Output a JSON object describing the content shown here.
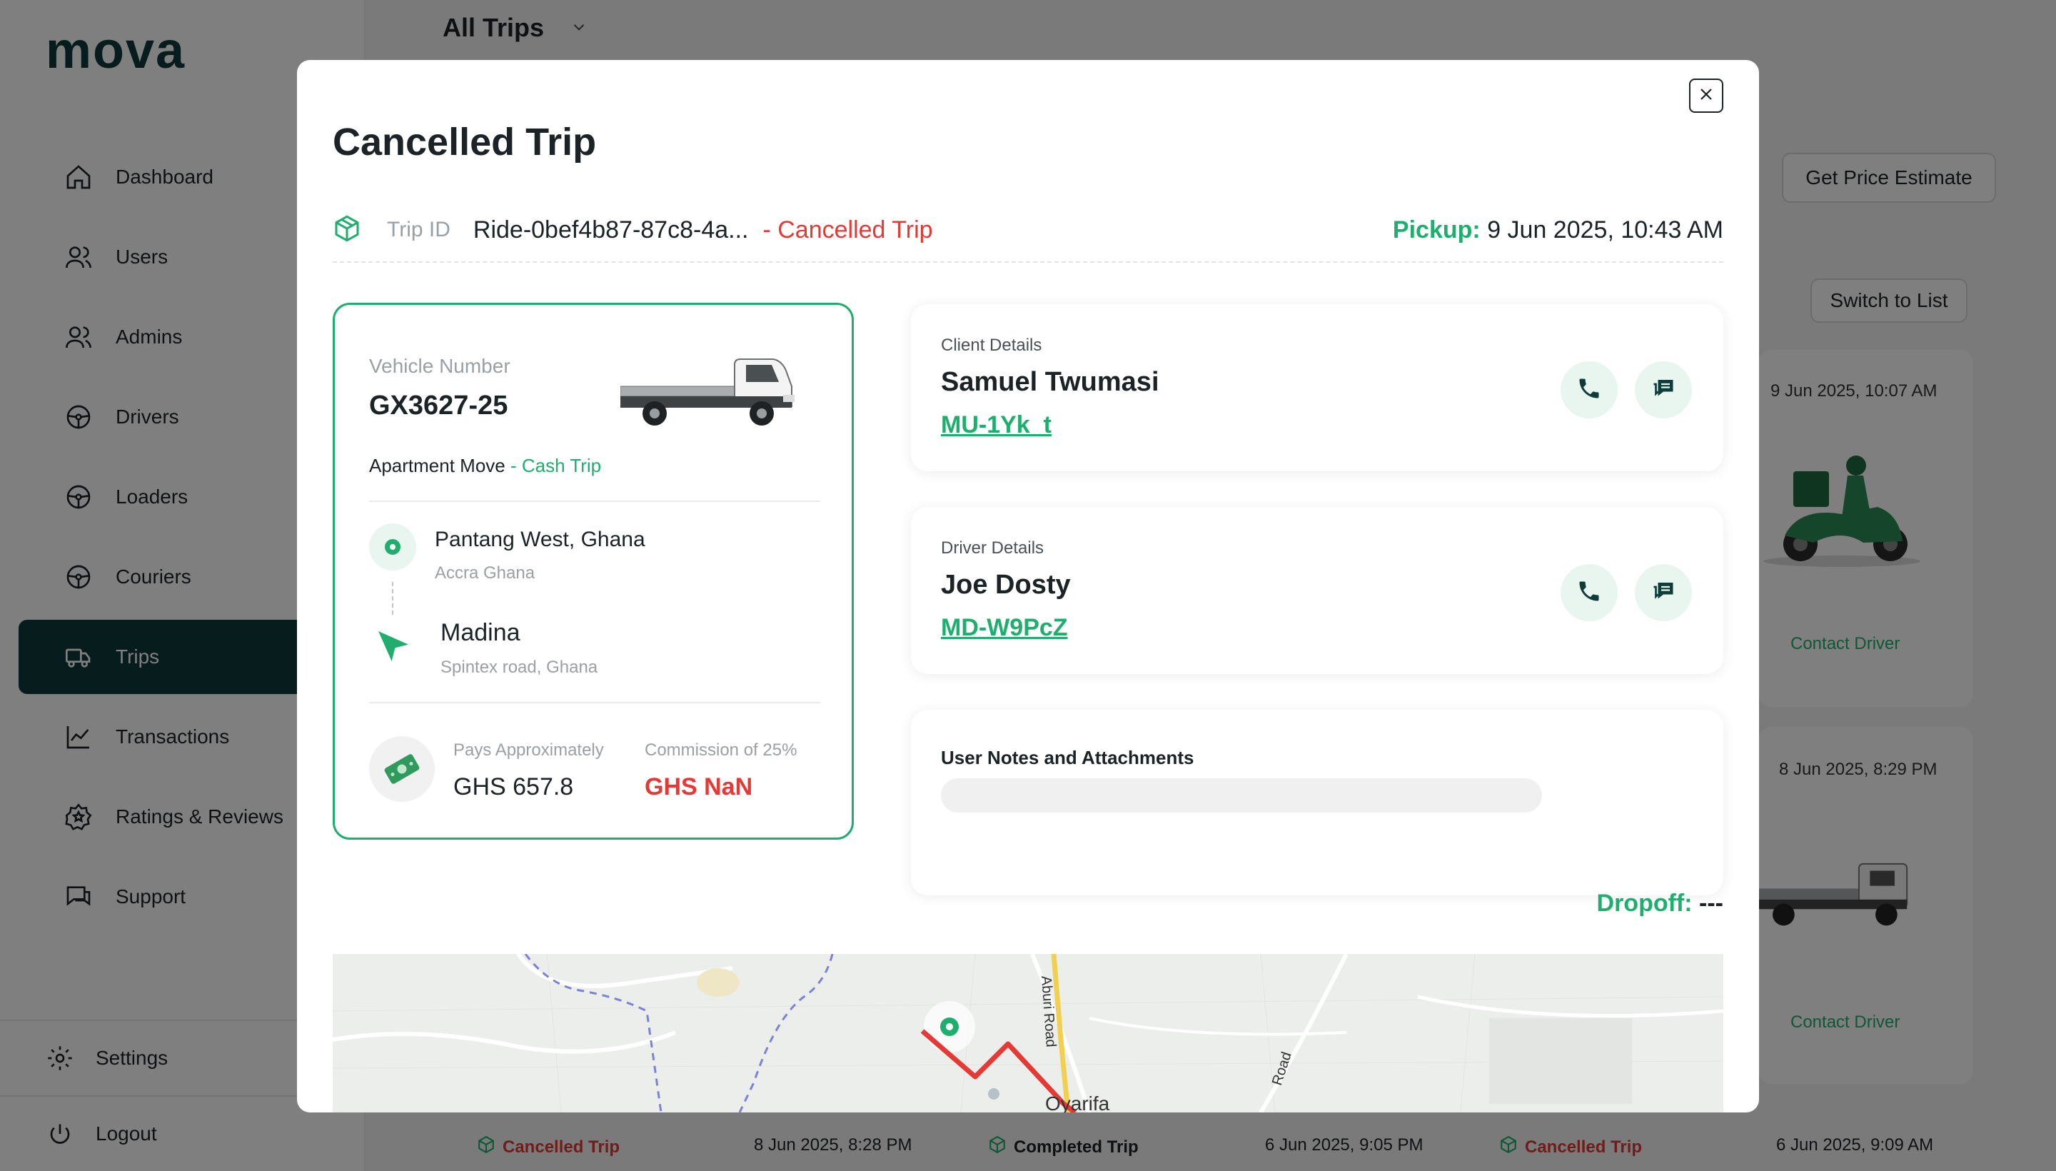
{
  "app": {
    "logo": "mova",
    "nav": [
      {
        "label": "Dashboard",
        "icon": "home-icon"
      },
      {
        "label": "Users",
        "icon": "users-icon"
      },
      {
        "label": "Admins",
        "icon": "admins-icon"
      },
      {
        "label": "Drivers",
        "icon": "steering-wheel-icon"
      },
      {
        "label": "Loaders",
        "icon": "steering-wheel-icon"
      },
      {
        "label": "Couriers",
        "icon": "steering-wheel-icon"
      },
      {
        "label": "Trips",
        "icon": "truck-icon",
        "active": true
      },
      {
        "label": "Transactions",
        "icon": "chart-line-icon"
      },
      {
        "label": "Ratings & Reviews",
        "icon": "star-badge-icon"
      },
      {
        "label": "Support",
        "icon": "chat-icon"
      }
    ],
    "settings_label": "Settings",
    "logout_label": "Logout",
    "filter_label": "All Trips",
    "price_estimate_label": "Get Price Estimate",
    "switch_list_label": "Switch to List",
    "bg_cards": [
      {
        "date": "9 Jun 2025, 10:07 AM",
        "contact": "Contact Driver"
      },
      {
        "date": "8 Jun 2025, 8:29 PM",
        "contact": "Contact Driver"
      }
    ],
    "bottom_trips": [
      {
        "status": "Cancelled Trip",
        "date": "8 Jun 2025, 8:28 PM",
        "kind": "cancel"
      },
      {
        "status": "Completed Trip",
        "date": "6 Jun 2025, 9:05 PM",
        "kind": "done"
      },
      {
        "status": "Cancelled Trip",
        "date": "6 Jun 2025, 9:09 AM",
        "kind": "cancel"
      }
    ]
  },
  "modal": {
    "title": "Cancelled Trip",
    "trip_id_label": "Trip ID",
    "trip_id": "Ride-0bef4b87-87c8-4a...",
    "status_text": "- Cancelled Trip",
    "pickup_label": "Pickup:",
    "pickup_time": "9 Jun 2025, 10:43 AM",
    "vehicle": {
      "number_label": "Vehicle Number",
      "number": "GX3627-25",
      "trip_type": "Apartment Move",
      "payment_type": "- Cash Trip"
    },
    "route": {
      "from": "Pantang West, Ghana",
      "from_sub": "Accra Ghana",
      "to": "Madina",
      "to_sub": "Spintex road, Ghana"
    },
    "fare": {
      "pays_label": "Pays Approximately",
      "pays_value": "GHS 657.8",
      "commission_label": "Commission of 25%",
      "commission_value": "GHS NaN"
    },
    "client": {
      "label": "Client Details",
      "name": "Samuel Twumasi",
      "id": "MU-1Yk_t"
    },
    "driver": {
      "label": "Driver Details",
      "name": "Joe Dosty",
      "id": "MD-W9PcZ"
    },
    "notes_label": "User Notes and Attachments",
    "dropoff_label": "Dropoff:",
    "dropoff_value": "---",
    "map": {
      "road_label_1": "Aburi Road",
      "road_label_2": "Road",
      "place_label": "Oyarifa"
    }
  },
  "colors": {
    "brand_dark": "#0f3b3a",
    "accent_green": "#1fae6e",
    "danger_red": "#e53935"
  }
}
